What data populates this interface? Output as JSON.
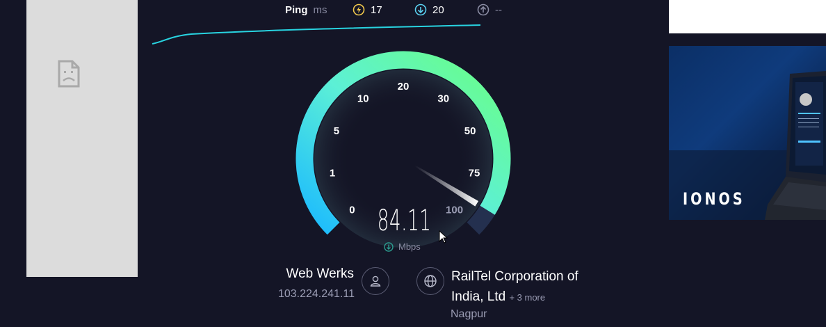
{
  "ping": {
    "label": "Ping",
    "unit": "ms",
    "idle": "17",
    "download": "20",
    "upload": "--"
  },
  "gauge": {
    "ticks": [
      "0",
      "1",
      "5",
      "10",
      "20",
      "30",
      "50",
      "75",
      "100"
    ],
    "fraction": 0.95,
    "value": "84.11",
    "unit": "Mbps"
  },
  "server": {
    "name": "Web Werks",
    "ip": "103.224.241.11"
  },
  "isp": {
    "name": "RailTel Corporation of India, Ltd",
    "more": "+ 3 more",
    "city": "Nagpur"
  },
  "ad": {
    "brand": "IONOS"
  },
  "colors": {
    "background": "#141526",
    "arc_start": "#1ab9ff",
    "arc_end": "#6bff83",
    "line": "#28d3e0"
  }
}
